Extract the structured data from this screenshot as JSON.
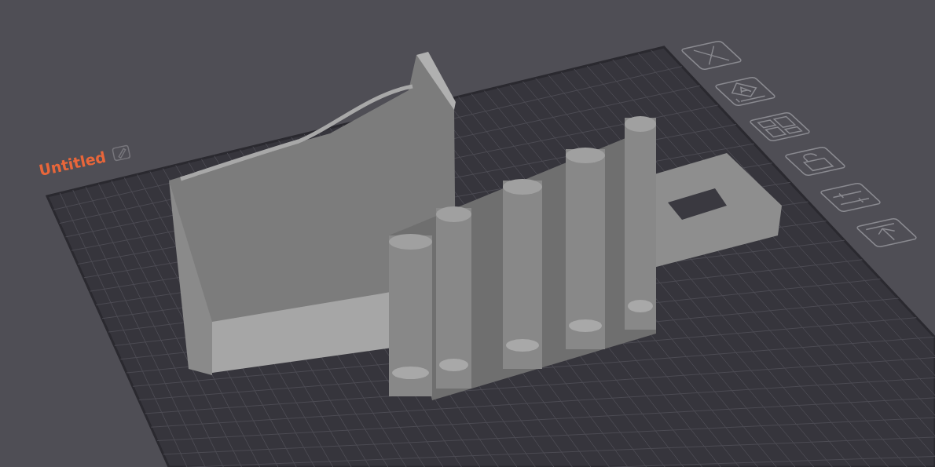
{
  "project": {
    "title": "Untitled"
  }
}
